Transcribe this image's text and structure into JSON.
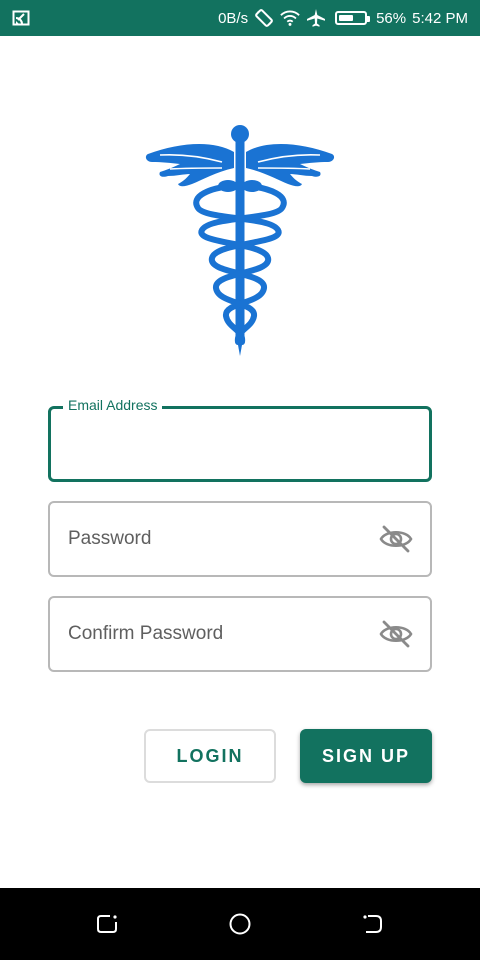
{
  "status_bar": {
    "speed": "0B/s",
    "battery_percent_label": "56%",
    "battery_level": 0.56,
    "time": "5:42 PM",
    "icons": [
      "cast-icon",
      "screen-rotation-icon",
      "wifi-icon",
      "airplane-icon",
      "battery-icon"
    ]
  },
  "logo": {
    "icon": "caduceus-icon",
    "color": "#1a73d3"
  },
  "form": {
    "email": {
      "label": "Email Address",
      "value": ""
    },
    "password": {
      "placeholder": "Password",
      "value": "",
      "icon": "eye-off-icon"
    },
    "confirm_password": {
      "placeholder": "Confirm Password",
      "value": "",
      "icon": "eye-off-icon"
    }
  },
  "buttons": {
    "login": "LOGIN",
    "signup": "SIGN UP"
  },
  "nav": {
    "icons": [
      "recents-icon",
      "home-icon",
      "back-icon"
    ]
  },
  "colors": {
    "accent": "#12725f",
    "logo_blue": "#1a73d3"
  }
}
